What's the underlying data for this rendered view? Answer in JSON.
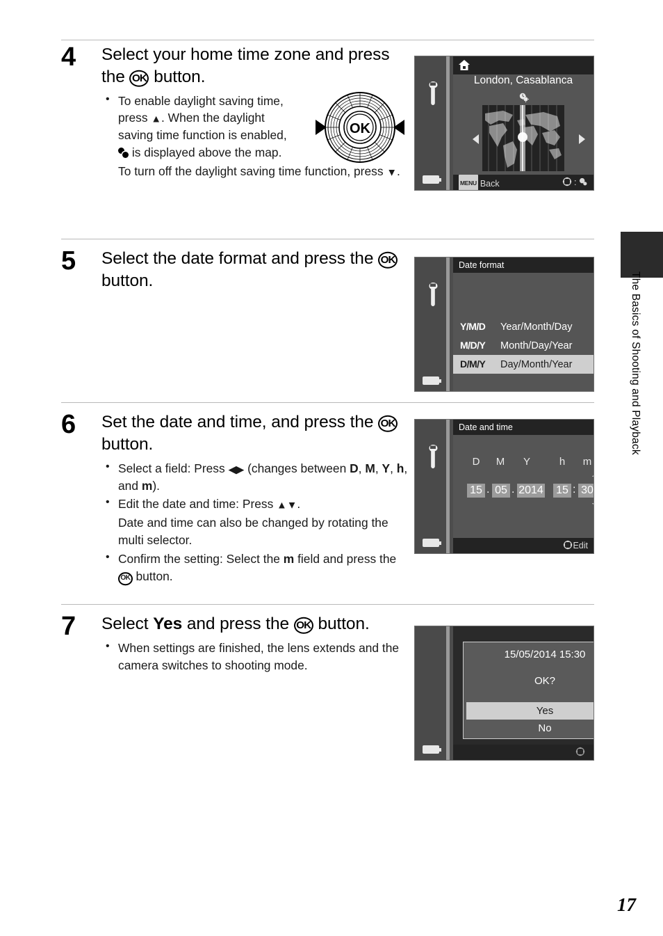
{
  "page": {
    "number": "17",
    "chapter_tab_label": "The Basics of Shooting and Playback"
  },
  "steps": [
    {
      "number": "4",
      "title_parts": [
        "Select your home time zone and press the ",
        "OK",
        " button."
      ],
      "bullets": [
        "To enable daylight saving time, press ▲. When the daylight saving time function is enabled, ☀ is displayed above the map.",
        "To turn off the daylight saving time function, press ▼."
      ]
    },
    {
      "number": "5",
      "title_parts": [
        "Select the date format and press the ",
        "OK",
        " button."
      ],
      "bullets": []
    },
    {
      "number": "6",
      "title_parts": [
        "Set the date and time, and press the ",
        "OK",
        " button."
      ],
      "bullets": [
        "Select a field: Press ◀▶ (changes between D, M, Y, h, and m).",
        "Edit the date and time: Press ▲▼.",
        "Date and time can also be changed by rotating the multi selector.",
        "Confirm the setting: Select the m field and press the OK button."
      ]
    },
    {
      "number": "7",
      "title_parts": [
        "Select ",
        "Yes",
        " and press the ",
        "OK",
        " button."
      ],
      "bullets": [
        "When settings are finished, the lens extends and the camera switches to shooting mode."
      ]
    }
  ],
  "multi_selector": {
    "center_label": "OK",
    "left_arrow": "◀",
    "right_arrow": "▶"
  },
  "screens": {
    "timezone": {
      "home_icon": "home-icon",
      "city": "London, Casablanca",
      "dst_icon": "daylight-saving-icon",
      "back_badge": "MENU",
      "back_label": "Back",
      "hint_separator": ":",
      "left_arrow": "◀",
      "right_arrow": "▶"
    },
    "date_format": {
      "title": "Date format",
      "options": [
        {
          "code": "Y/M/D",
          "label": "Year/Month/Day",
          "selected": false
        },
        {
          "code": "M/D/Y",
          "label": "Month/Day/Year",
          "selected": false
        },
        {
          "code": "D/M/Y",
          "label": "Day/Month/Year",
          "selected": true
        }
      ]
    },
    "date_time": {
      "title": "Date and time",
      "headers": [
        "D",
        "M",
        "Y",
        "h",
        "m"
      ],
      "values": {
        "day": "15",
        "month": "05",
        "year": "2014",
        "hour": "15",
        "minute": "30"
      },
      "date_separator": ".",
      "time_separator": ":",
      "edit_label": "Edit"
    },
    "confirm": {
      "datetime": "15/05/2014  15:30",
      "question": "OK?",
      "yes_label": "Yes",
      "no_label": "No"
    }
  },
  "colors": {
    "lcd_bg": "#555555",
    "lcd_dark": "#232323",
    "lcd_sidebar": "#4a4a4a",
    "highlight": "#cfcfcf",
    "rule": "#b9b9b9",
    "tab": "#2b2b2b"
  }
}
